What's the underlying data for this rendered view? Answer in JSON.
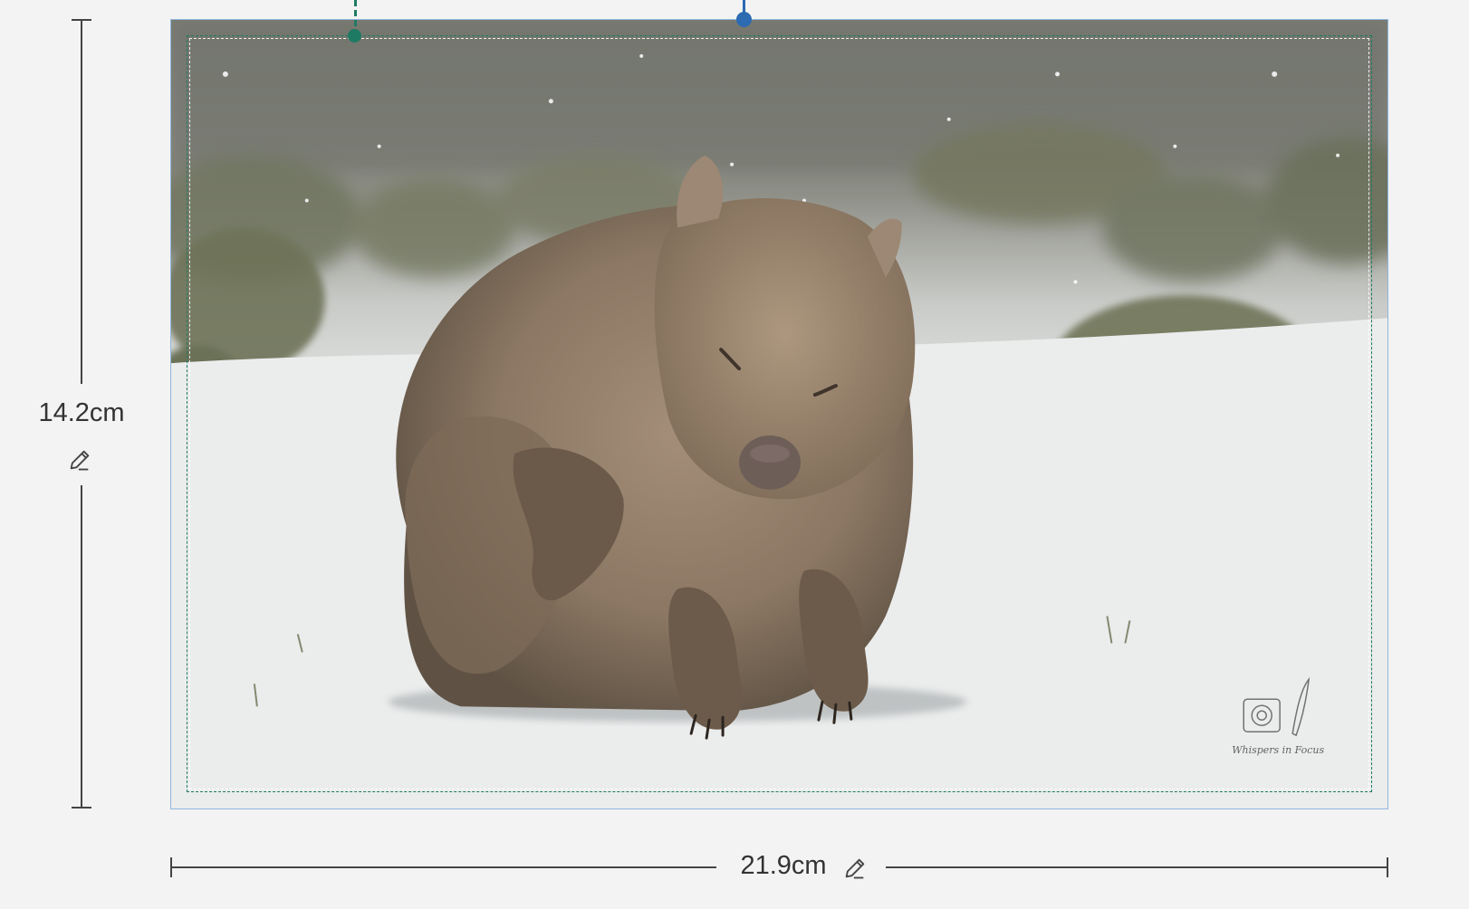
{
  "dimensions": {
    "height_label": "14.2cm",
    "width_label": "21.9cm"
  },
  "photo": {
    "subject": "wombat in snow",
    "watermark_line1": "Whispers in Focus"
  },
  "colors": {
    "bleed_line": "#1f7a64",
    "safe_line": "#ffffff",
    "selection_border": "#8fb6dd",
    "handle_blue": "#2c6ab1",
    "handle_green": "#1f7a64",
    "background": "#f3f3f3"
  },
  "icons": {
    "edit_height": "pencil-icon",
    "edit_width": "pencil-icon"
  }
}
